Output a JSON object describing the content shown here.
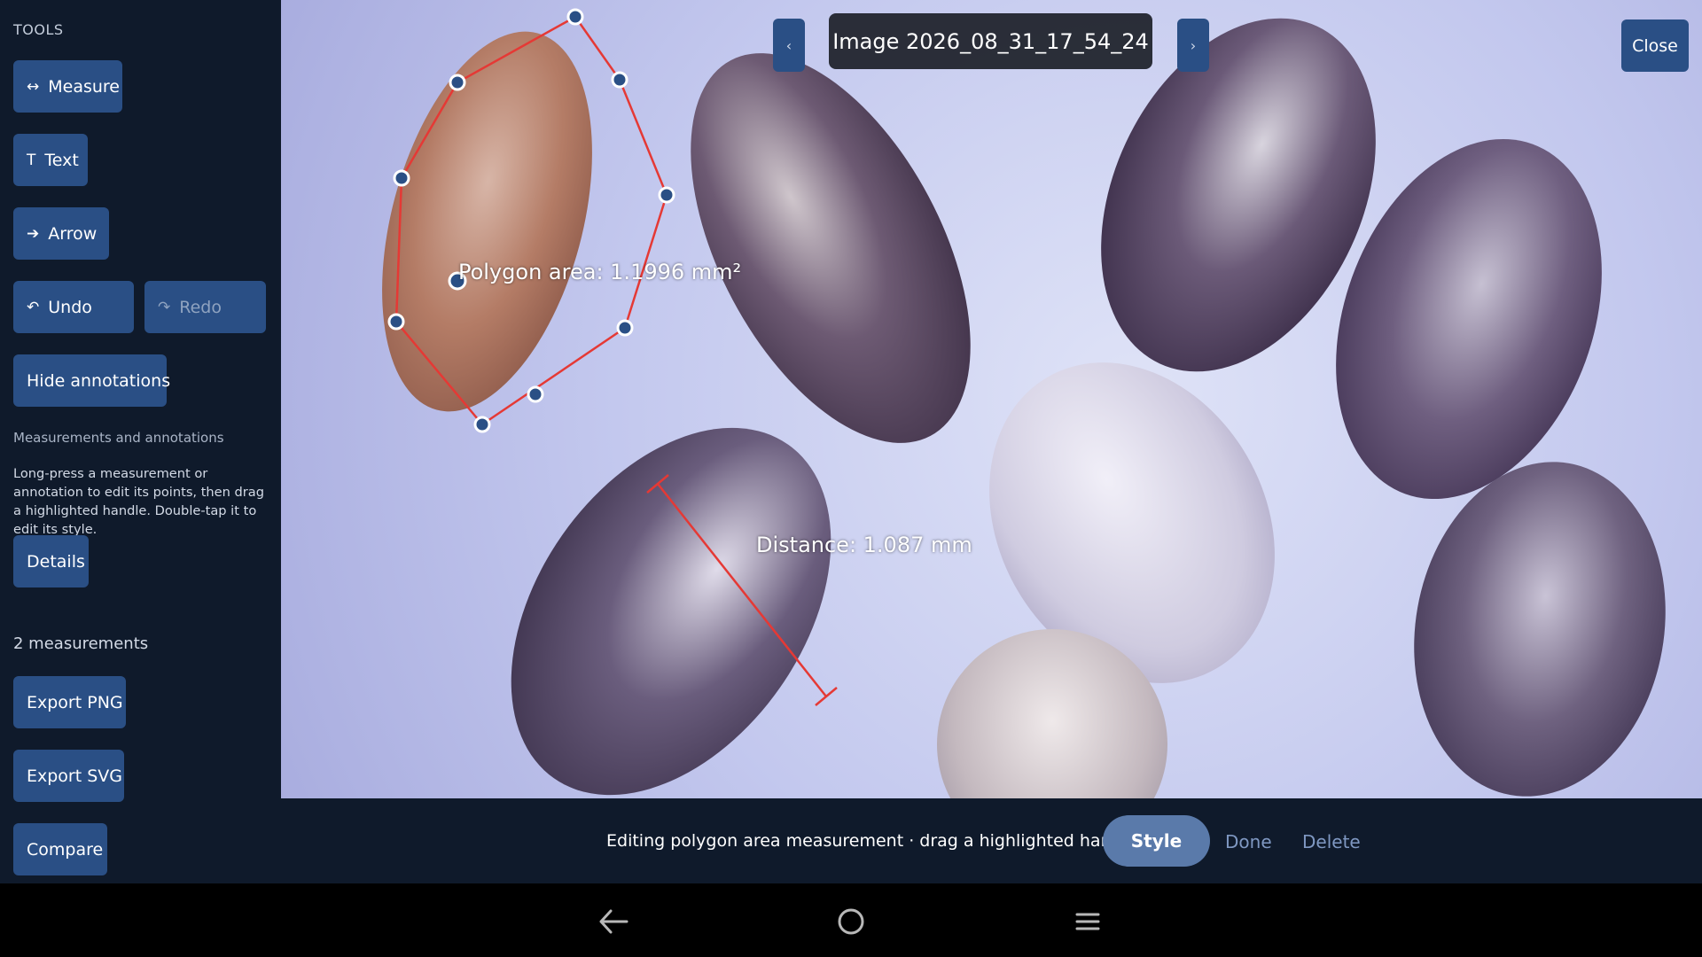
{
  "sidebar": {
    "section_title": "TOOLS",
    "buttons": {
      "measure": {
        "icon": "↔",
        "label": "Measure"
      },
      "text": {
        "icon": "T",
        "label": "Text"
      },
      "arrow": {
        "icon": "➔",
        "label": "Arrow"
      },
      "undo": {
        "icon": "↶",
        "label": "Undo"
      },
      "redo": {
        "icon": "↷",
        "label": "Redo"
      },
      "hide_annotations": "Hide annotations",
      "details": "Details",
      "export_png": "Export PNG",
      "export_svg": "Export SVG",
      "compare": "Compare"
    },
    "section_label": "Measurements and annotations",
    "help_text": "Long-press a measurement or annotation to edit its points, then drag a highlighted handle. Double-tap it to edit its style.",
    "measurement_count": "2 measurements"
  },
  "viewer": {
    "title": "Image 2026_08_31_17_54_24",
    "prev": "‹",
    "next": "›",
    "close": "Close",
    "annotations": {
      "polygon_label": "Polygon area: 1.1996 mm²",
      "distance_label": "Distance: 1.087 mm",
      "color": "#e53935"
    }
  },
  "editbar": {
    "status": "Editing polygon area measurement · drag a highlighted handle",
    "style": "Style",
    "done": "Done",
    "delete": "Delete"
  },
  "colors": {
    "sidebar_bg": "#0f1a2b",
    "button": "#2a4f85",
    "accent": "#5a7aaa"
  },
  "system_nav": {
    "back": "back-icon",
    "home": "home-icon",
    "menu": "menu-icon"
  }
}
